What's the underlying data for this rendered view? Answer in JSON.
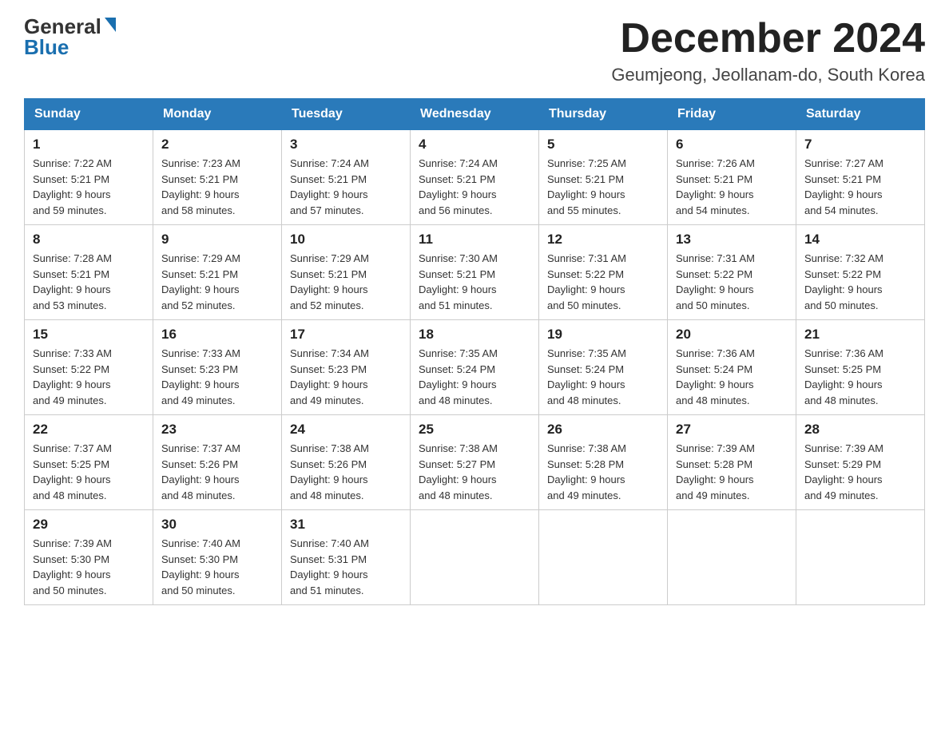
{
  "header": {
    "logo_general": "General",
    "logo_blue": "Blue",
    "month_title": "December 2024",
    "location": "Geumjeong, Jeollanam-do, South Korea"
  },
  "weekdays": [
    "Sunday",
    "Monday",
    "Tuesday",
    "Wednesday",
    "Thursday",
    "Friday",
    "Saturday"
  ],
  "weeks": [
    [
      {
        "day": "1",
        "sunrise": "7:22 AM",
        "sunset": "5:21 PM",
        "daylight": "9 hours and 59 minutes."
      },
      {
        "day": "2",
        "sunrise": "7:23 AM",
        "sunset": "5:21 PM",
        "daylight": "9 hours and 58 minutes."
      },
      {
        "day": "3",
        "sunrise": "7:24 AM",
        "sunset": "5:21 PM",
        "daylight": "9 hours and 57 minutes."
      },
      {
        "day": "4",
        "sunrise": "7:24 AM",
        "sunset": "5:21 PM",
        "daylight": "9 hours and 56 minutes."
      },
      {
        "day": "5",
        "sunrise": "7:25 AM",
        "sunset": "5:21 PM",
        "daylight": "9 hours and 55 minutes."
      },
      {
        "day": "6",
        "sunrise": "7:26 AM",
        "sunset": "5:21 PM",
        "daylight": "9 hours and 54 minutes."
      },
      {
        "day": "7",
        "sunrise": "7:27 AM",
        "sunset": "5:21 PM",
        "daylight": "9 hours and 54 minutes."
      }
    ],
    [
      {
        "day": "8",
        "sunrise": "7:28 AM",
        "sunset": "5:21 PM",
        "daylight": "9 hours and 53 minutes."
      },
      {
        "day": "9",
        "sunrise": "7:29 AM",
        "sunset": "5:21 PM",
        "daylight": "9 hours and 52 minutes."
      },
      {
        "day": "10",
        "sunrise": "7:29 AM",
        "sunset": "5:21 PM",
        "daylight": "9 hours and 52 minutes."
      },
      {
        "day": "11",
        "sunrise": "7:30 AM",
        "sunset": "5:21 PM",
        "daylight": "9 hours and 51 minutes."
      },
      {
        "day": "12",
        "sunrise": "7:31 AM",
        "sunset": "5:22 PM",
        "daylight": "9 hours and 50 minutes."
      },
      {
        "day": "13",
        "sunrise": "7:31 AM",
        "sunset": "5:22 PM",
        "daylight": "9 hours and 50 minutes."
      },
      {
        "day": "14",
        "sunrise": "7:32 AM",
        "sunset": "5:22 PM",
        "daylight": "9 hours and 50 minutes."
      }
    ],
    [
      {
        "day": "15",
        "sunrise": "7:33 AM",
        "sunset": "5:22 PM",
        "daylight": "9 hours and 49 minutes."
      },
      {
        "day": "16",
        "sunrise": "7:33 AM",
        "sunset": "5:23 PM",
        "daylight": "9 hours and 49 minutes."
      },
      {
        "day": "17",
        "sunrise": "7:34 AM",
        "sunset": "5:23 PM",
        "daylight": "9 hours and 49 minutes."
      },
      {
        "day": "18",
        "sunrise": "7:35 AM",
        "sunset": "5:24 PM",
        "daylight": "9 hours and 48 minutes."
      },
      {
        "day": "19",
        "sunrise": "7:35 AM",
        "sunset": "5:24 PM",
        "daylight": "9 hours and 48 minutes."
      },
      {
        "day": "20",
        "sunrise": "7:36 AM",
        "sunset": "5:24 PM",
        "daylight": "9 hours and 48 minutes."
      },
      {
        "day": "21",
        "sunrise": "7:36 AM",
        "sunset": "5:25 PM",
        "daylight": "9 hours and 48 minutes."
      }
    ],
    [
      {
        "day": "22",
        "sunrise": "7:37 AM",
        "sunset": "5:25 PM",
        "daylight": "9 hours and 48 minutes."
      },
      {
        "day": "23",
        "sunrise": "7:37 AM",
        "sunset": "5:26 PM",
        "daylight": "9 hours and 48 minutes."
      },
      {
        "day": "24",
        "sunrise": "7:38 AM",
        "sunset": "5:26 PM",
        "daylight": "9 hours and 48 minutes."
      },
      {
        "day": "25",
        "sunrise": "7:38 AM",
        "sunset": "5:27 PM",
        "daylight": "9 hours and 48 minutes."
      },
      {
        "day": "26",
        "sunrise": "7:38 AM",
        "sunset": "5:28 PM",
        "daylight": "9 hours and 49 minutes."
      },
      {
        "day": "27",
        "sunrise": "7:39 AM",
        "sunset": "5:28 PM",
        "daylight": "9 hours and 49 minutes."
      },
      {
        "day": "28",
        "sunrise": "7:39 AM",
        "sunset": "5:29 PM",
        "daylight": "9 hours and 49 minutes."
      }
    ],
    [
      {
        "day": "29",
        "sunrise": "7:39 AM",
        "sunset": "5:30 PM",
        "daylight": "9 hours and 50 minutes."
      },
      {
        "day": "30",
        "sunrise": "7:40 AM",
        "sunset": "5:30 PM",
        "daylight": "9 hours and 50 minutes."
      },
      {
        "day": "31",
        "sunrise": "7:40 AM",
        "sunset": "5:31 PM",
        "daylight": "9 hours and 51 minutes."
      },
      null,
      null,
      null,
      null
    ]
  ]
}
